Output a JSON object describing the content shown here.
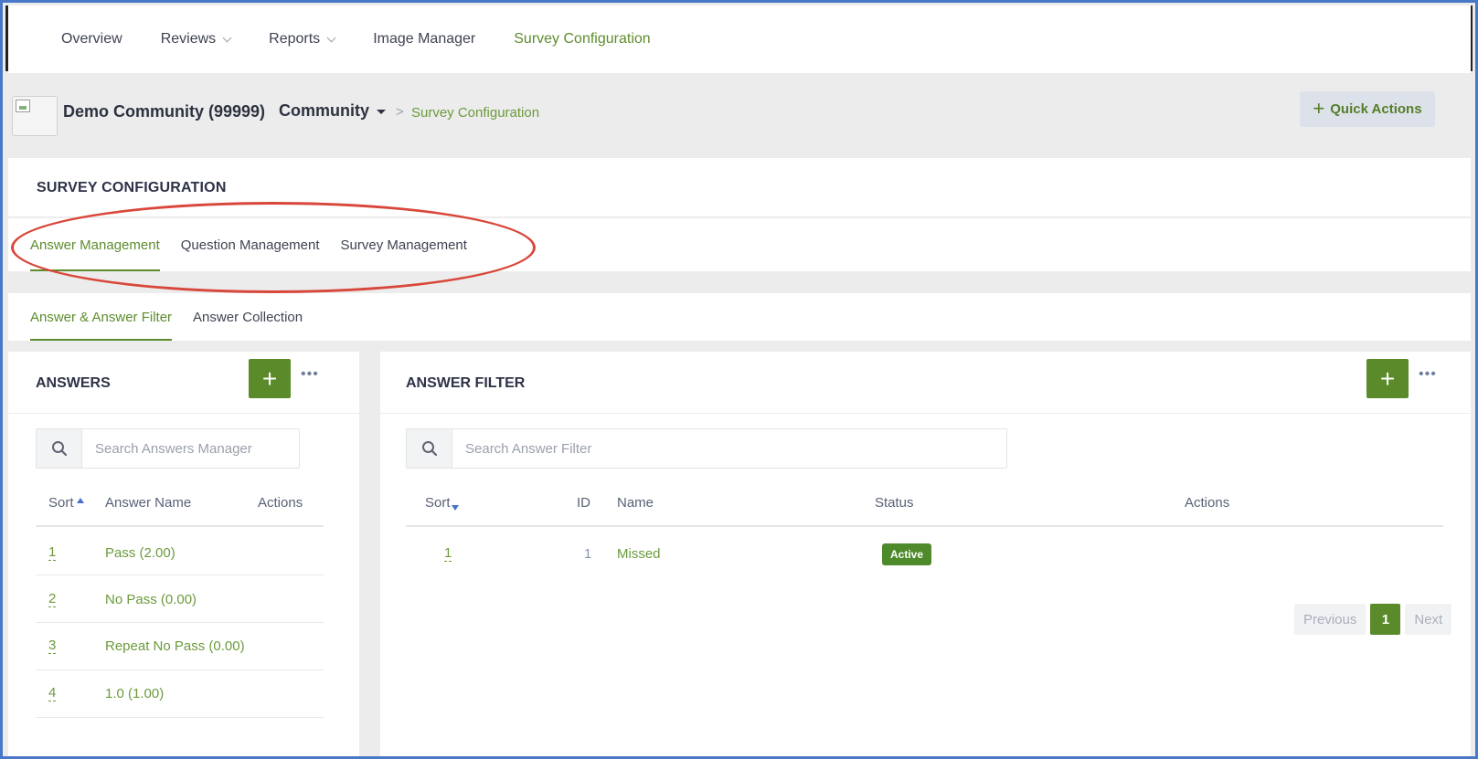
{
  "nav": {
    "items": [
      {
        "label": "Overview",
        "dropdown": false,
        "active": false
      },
      {
        "label": "Reviews",
        "dropdown": true,
        "active": false
      },
      {
        "label": "Reports",
        "dropdown": true,
        "active": false
      },
      {
        "label": "Image Manager",
        "dropdown": false,
        "active": false
      },
      {
        "label": "Survey Configuration",
        "dropdown": false,
        "active": true
      }
    ]
  },
  "breadcrumb": {
    "community_name": "Demo Community (99999)",
    "scope_label": "Community",
    "separator": ">",
    "current": "Survey Configuration"
  },
  "quick_actions": {
    "icon": "+",
    "label": "Quick Actions"
  },
  "section": {
    "title": "SURVEY CONFIGURATION"
  },
  "primary_tabs": [
    "Answer Management",
    "Question Management",
    "Survey Management"
  ],
  "secondary_tabs": [
    "Answer & Answer Filter",
    "Answer Collection"
  ],
  "answers_panel": {
    "title": "ANSWERS",
    "add_icon": "+",
    "more_icon": "•••",
    "search_placeholder": "Search Answers Manager",
    "columns": [
      "Sort",
      "Answer Name",
      "Actions"
    ],
    "rows": [
      {
        "sort": "1",
        "name": "Pass (2.00)"
      },
      {
        "sort": "2",
        "name": "No Pass (0.00)"
      },
      {
        "sort": "3",
        "name": "Repeat No Pass (0.00)"
      },
      {
        "sort": "4",
        "name": "1.0 (1.00)"
      }
    ]
  },
  "filter_panel": {
    "title": "ANSWER FILTER",
    "add_icon": "+",
    "more_icon": "•••",
    "search_placeholder": "Search Answer Filter",
    "columns": [
      "Sort",
      "ID",
      "Name",
      "Status",
      "Actions"
    ],
    "rows": [
      {
        "sort": "1",
        "id": "1",
        "name": "Missed",
        "status": "Active"
      }
    ],
    "pagination": {
      "previous": "Previous",
      "page": "1",
      "next": "Next"
    }
  },
  "colors": {
    "accent_green": "#5a8a2a",
    "annotation_red": "#d9473a",
    "frame_blue": "#4a78c8"
  }
}
